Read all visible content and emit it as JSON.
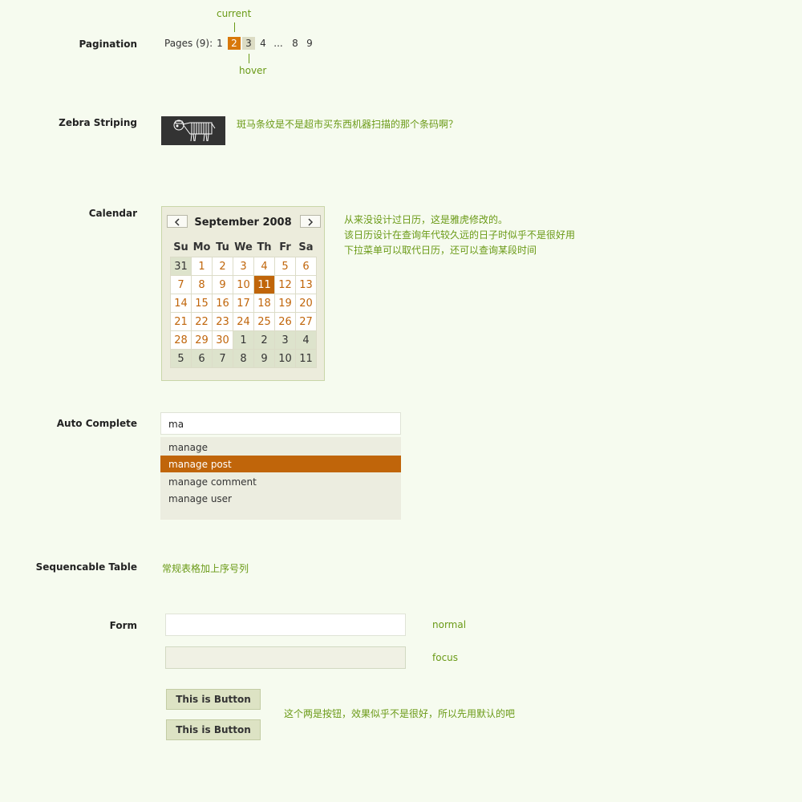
{
  "sections": {
    "pagination": "Pagination",
    "zebra": "Zebra Striping",
    "calendar": "Calendar",
    "autocomplete": "Auto Complete",
    "table": "Sequencable Table",
    "form": "Form"
  },
  "pagination": {
    "label": "Pages (9):",
    "pages": [
      "1",
      "2",
      "3",
      "4",
      "...",
      "8",
      "9"
    ],
    "current_page": "2",
    "hover_page": "3",
    "current_annotation": "current",
    "hover_annotation": "hover"
  },
  "zebra": {
    "note": "斑马条纹是不是超市买东西机器扫描的那个条码啊？"
  },
  "calendar": {
    "title": "September 2008",
    "weekdays": [
      "Su",
      "Mo",
      "Tu",
      "We",
      "Th",
      "Fr",
      "Sa"
    ],
    "weeks": [
      [
        "31",
        "1",
        "2",
        "3",
        "4",
        "5",
        "6"
      ],
      [
        "7",
        "8",
        "9",
        "10",
        "11",
        "12",
        "13"
      ],
      [
        "14",
        "15",
        "16",
        "17",
        "18",
        "19",
        "20"
      ],
      [
        "21",
        "22",
        "23",
        "24",
        "25",
        "26",
        "27"
      ],
      [
        "28",
        "29",
        "30",
        "1",
        "2",
        "3",
        "4"
      ],
      [
        "5",
        "6",
        "7",
        "8",
        "9",
        "10",
        "11"
      ]
    ],
    "selected_day": "11",
    "notes": [
      "从来没设计过日历，这是雅虎修改的。",
      "该日历设计在查询年代较久远的日子时似乎不是很好用",
      "下拉菜单可以取代日历，还可以查询某段时间"
    ]
  },
  "autocomplete": {
    "value": "ma",
    "suggestions": [
      "manage",
      "manage post",
      "manage comment",
      "manage user"
    ],
    "selected": "manage post"
  },
  "table": {
    "note": "常规表格加上序号列"
  },
  "form": {
    "normal_note": "normal",
    "focus_note": "focus",
    "button_label": "This is Button",
    "button_note": "这个两是按钮，效果似乎不是很好，所以先用默认的吧"
  },
  "colors": {
    "background": "#f6fbef",
    "accent": "#c0650a",
    "note": "#6a9a16",
    "muted_cell": "#dde3cc"
  }
}
